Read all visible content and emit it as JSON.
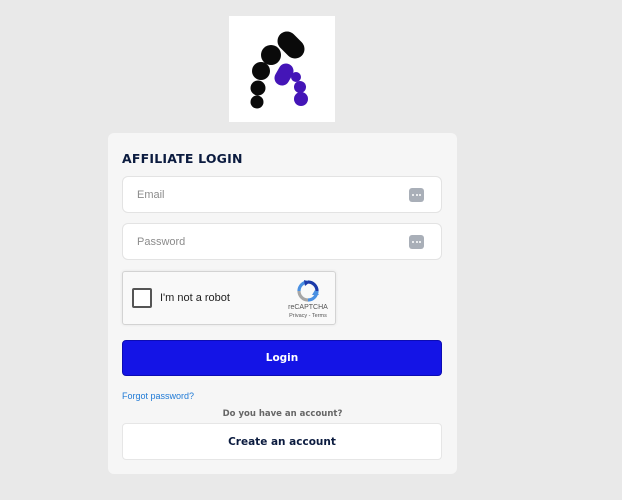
{
  "logo": {
    "icon": "affiliate-logo-icon",
    "colors": {
      "dark": "#0a0a0a",
      "accent": "#4415b7"
    }
  },
  "login_card": {
    "title": "AFFILIATE LOGIN",
    "email": {
      "placeholder": "Email",
      "value": ""
    },
    "password": {
      "placeholder": "Password",
      "value": ""
    },
    "field_icon": "password-manager-icon",
    "recaptcha": {
      "label": "I'm not a robot",
      "brand": "reCAPTCHA",
      "links": "Privacy - Terms",
      "checked": false
    },
    "login_label": "Login",
    "forgot_password": "Forgot password?",
    "have_account": "Do you have an account?",
    "create_account": "Create an account"
  },
  "colors": {
    "primary": "#1414e6",
    "link": "#1f7ad6",
    "heading": "#0b1b3f",
    "background": "#e9e9e9",
    "card": "#f6f6f6"
  }
}
